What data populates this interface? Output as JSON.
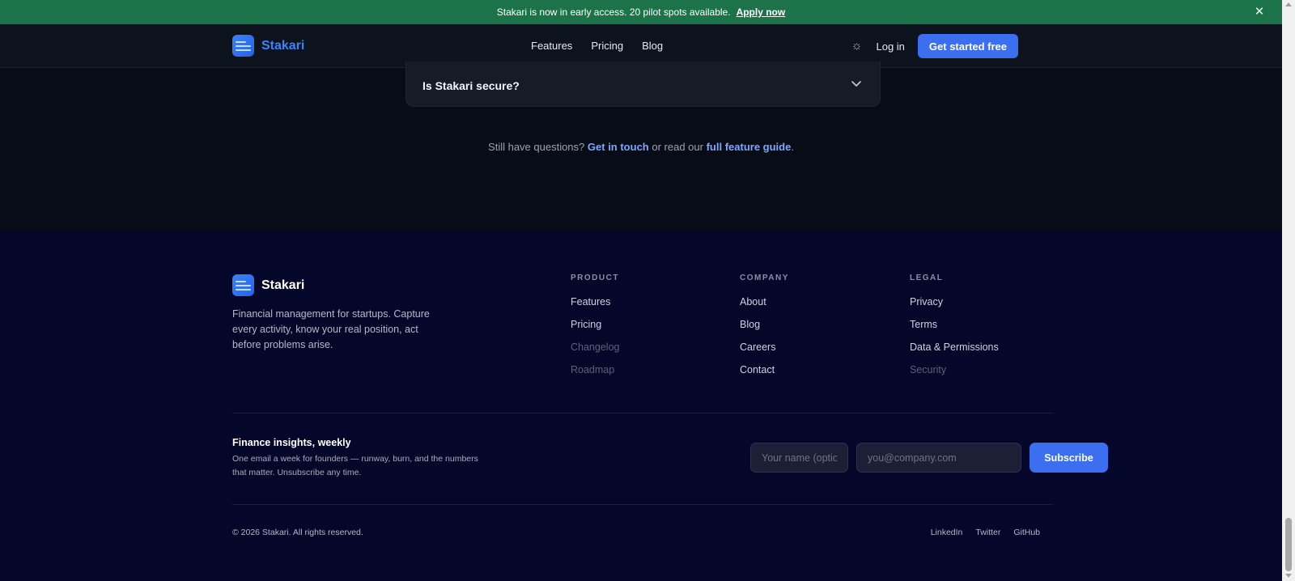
{
  "banner": {
    "text": "Stakari is now in early access. 20 pilot spots available.",
    "link": "Apply now",
    "close_icon": "close-icon"
  },
  "nav": {
    "brand": "Stakari",
    "links": [
      "Features",
      "Pricing",
      "Blog"
    ],
    "theme_icon": "sun-icon",
    "login": "Log in",
    "cta": "Get started free"
  },
  "faq": {
    "question": "Is Stakari secure?",
    "chevron_icon": "chevron-down-icon"
  },
  "still": {
    "prefix": "Still have questions?",
    "link1": "Get in touch",
    "middle": "or read our",
    "link2": "full feature guide",
    "suffix": "."
  },
  "footer": {
    "brand": "Stakari",
    "description": "Financial management for startups. Capture every activity, know your real position, act before problems arise.",
    "columns": [
      {
        "heading": "PRODUCT",
        "links": [
          "Features",
          "Pricing",
          "Changelog",
          "Roadmap"
        ]
      },
      {
        "heading": "COMPANY",
        "links": [
          "About",
          "Blog",
          "Careers",
          "Contact"
        ]
      },
      {
        "heading": "LEGAL",
        "links": [
          "Privacy",
          "Terms",
          "Data & Permissions",
          "Security"
        ]
      }
    ],
    "newsletter": {
      "title": "Finance insights, weekly",
      "description": "One email a week for founders — runway, burn, and the numbers that matter. Unsubscribe any time.",
      "name_placeholder": "Your name (optional)",
      "email_placeholder": "you@company.com",
      "button": "Subscribe"
    },
    "copyright": "© 2026 Stakari. All rights reserved.",
    "socials": [
      "LinkedIn",
      "Twitter",
      "GitHub"
    ]
  },
  "colors": {
    "banner": "#1c7249",
    "accent": "#3b6ff0",
    "footer_bg": "#04062a",
    "page_bg": "#070c16"
  }
}
